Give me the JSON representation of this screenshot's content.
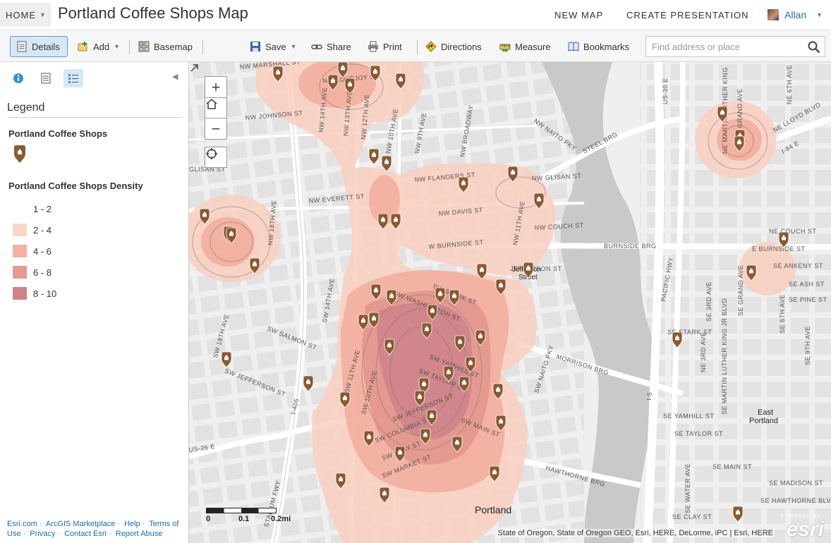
{
  "header": {
    "home_label": "HOME",
    "title": "Portland Coffee Shops Map",
    "new_map": "NEW MAP",
    "create_presentation": "CREATE PRESENTATION",
    "user_name": "Allan"
  },
  "toolbar": {
    "details": "Details",
    "add": "Add",
    "basemap": "Basemap",
    "save": "Save",
    "share": "Share",
    "print": "Print",
    "directions": "Directions",
    "measure": "Measure",
    "bookmarks": "Bookmarks",
    "search_placeholder": "Find address or place"
  },
  "sidebar": {
    "legend_title": "Legend",
    "layer1_title": "Portland Coffee Shops",
    "layer2_title": "Portland Coffee Shops Density",
    "classes": [
      {
        "label": "1 - 2",
        "color": "#ffffff"
      },
      {
        "label": "2 - 4",
        "color": "#fbd4c8"
      },
      {
        "label": "4 - 6",
        "color": "#f4b1a2"
      },
      {
        "label": "6 - 8",
        "color": "#e39a90"
      },
      {
        "label": "8 - 10",
        "color": "#cf8489"
      }
    ],
    "footer_links": [
      "Esri.com",
      "ArcGIS Marketplace",
      "Help",
      "Terms of Use",
      "Privacy",
      "Contact Esri",
      "Report Abuse"
    ]
  },
  "map": {
    "attribution": "State of Oregon, State of Oregon GEO, Esri, HERE, DeLorme, iPC | Esri, HERE",
    "powered_by": "POWERED BY",
    "esri": "esri",
    "scale_labels": [
      "0",
      "0.1",
      "0.2mi"
    ],
    "place_labels": {
      "portland": "Portland",
      "east_portland": "East\nPortland",
      "jefferson_street": "Jefferson\nStreet"
    },
    "street_labels": [
      "NW MARSHALL ST",
      "NW LOVEJOY ST",
      "NW JOHNSON ST",
      "NW GLISAN ST",
      "NW FLANDERS ST",
      "NW EVERETT ST",
      "NW DAVIS ST",
      "NW COUCH ST",
      "W BURNSIDE ST",
      "SW WASHINGTON ST",
      "SW STARK ST",
      "SW YAMHILL ST",
      "SW TAYLOR ST",
      "SW MAIN ST",
      "SW JEFFERSON ST",
      "SW COLUMBIA ST",
      "SW CLAY ST",
      "SW MARKET ST",
      "SW SALMON ST",
      "SW 18TH AVE",
      "SW 14TH AVE",
      "SW 11TH AVE",
      "SW 10TH AVE",
      "NW 10TH AVE",
      "NW 9TH AVE",
      "NW BROADWAY",
      "NW 14TH AVE",
      "NW 13TH AVE",
      "NW 12TH AVE",
      "NW 11TH AVE",
      "NW 18TH AVE",
      "STADIUM FWY",
      "I-405",
      "NW NAITO PKY",
      "SW NAITO PKY",
      "STEEL BRG",
      "BURNSIDE BRG",
      "MORRISON BRG",
      "HAWTHORNE BRG",
      "PACIFIC HWY",
      "I-5",
      "US-30 E",
      "NE COUCH ST",
      "E BURNSIDE ST",
      "SE ANKENY ST",
      "SE ASH ST",
      "SE PINE ST",
      "SE STARK ST",
      "SE YAMHILL ST",
      "SE TAYLOR ST",
      "SE MAIN ST",
      "SE MADISON ST",
      "SE HAWTHORNE BLVD",
      "SE CLAY ST",
      "SE WATER AVE",
      "SE 3RD AVE",
      "SE GRAND AVE",
      "SE 6TH AVE",
      "SE 9TH AVE",
      "SE MARTIN LUTHER KING JR BLVD",
      "NE MARTIN LUTHER KING",
      "NE GRAND AVE",
      "NE LLOYD BLVD",
      "I-84 E",
      "JEFFERSON ST",
      "SW JEFFERSON ST",
      "US-26 E",
      "W BURNSIDE ST",
      "GLISAN ST",
      "NW NAITO PKY",
      "NE 6TH AVE",
      "NE 3RD AVE"
    ]
  },
  "colors": {
    "accent_blue": "#1e6ab0",
    "marker_brown": "#8a5a30",
    "river": "#c8c8c8"
  }
}
